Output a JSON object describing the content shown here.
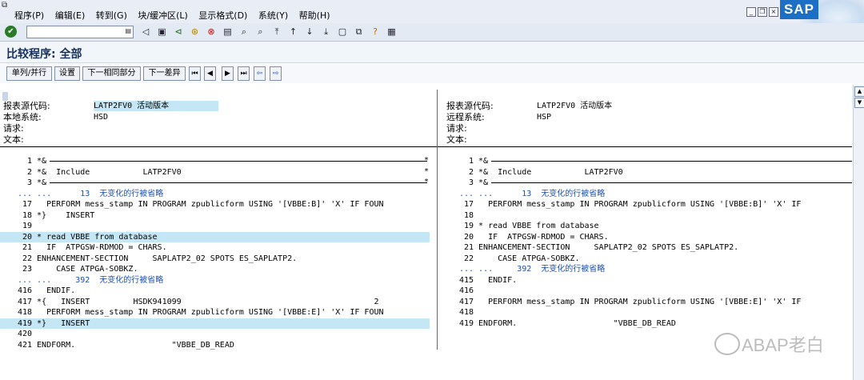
{
  "menubar": {
    "items": [
      "程序(P)",
      "编辑(E)",
      "转到(G)",
      "块/缓冲区(L)",
      "显示格式(D)",
      "系统(Y)",
      "帮助(H)"
    ],
    "logo": "SAP"
  },
  "toolbar": {
    "command_value": "",
    "icons": [
      "enter-icon",
      "back-icon",
      "exit-icon",
      "cancel-icon",
      "print-icon",
      "find-icon",
      "find-next-icon",
      "first-page-icon",
      "prev-page-icon",
      "next-page-icon",
      "last-page-icon",
      "new-session-icon",
      "shortcut-icon",
      "help-icon",
      "layout-icon"
    ]
  },
  "title": "比较程序: 全部",
  "app_toolbar": {
    "btn_split": "单列/并行",
    "btn_settings": "设置",
    "btn_next_same": "下一相同部分",
    "btn_next_diff": "下一差异"
  },
  "left": {
    "header": [
      {
        "label": "报表源代码:",
        "value": "LATP2FV0 活动版本"
      },
      {
        "label": "本地系统:",
        "value": "HSD"
      },
      {
        "label": "请求:",
        "value": ""
      },
      {
        "label": "文本:",
        "value": ""
      }
    ],
    "lines": [
      {
        "n": "1",
        "t": "*&"
      },
      {
        "n": "2",
        "t": "*&  Include           LATP2FV0"
      },
      {
        "n": "3",
        "t": "*&"
      },
      {
        "n": "...",
        "t": "...      13  无变化的行被省略"
      },
      {
        "n": "17",
        "t": "  PERFORM mess_stamp IN PROGRAM zpublicform USING '[VBBE:B]' 'X' IF FOUN"
      },
      {
        "n": "18",
        "t": "*}    INSERT"
      },
      {
        "n": "19",
        "t": ""
      },
      {
        "n": "20",
        "t": "* read VBBE from database"
      },
      {
        "n": "21",
        "t": "  IF  ATPGSW-RDMOD = CHARS."
      },
      {
        "n": "22",
        "t": "ENHANCEMENT-SECTION     SAPLATP2_02 SPOTS ES_SAPLATP2."
      },
      {
        "n": "23",
        "t": "    CASE ATPGA-SOBKZ."
      },
      {
        "n": "...",
        "t": "...     392  无变化的行被省略"
      },
      {
        "n": "416",
        "t": "  ENDIF."
      },
      {
        "n": "417",
        "t": "*{   INSERT         HSDK941099                                        2"
      },
      {
        "n": "418",
        "t": "  PERFORM mess_stamp IN PROGRAM zpublicform USING '[VBBE:E]' 'X' IF FOUN"
      },
      {
        "n": "419",
        "t": "*}   INSERT"
      },
      {
        "n": "420",
        "t": ""
      },
      {
        "n": "421",
        "t": "ENDFORM.                    \"VBBE_DB_READ"
      }
    ]
  },
  "right": {
    "header": [
      {
        "label": "报表源代码:",
        "value": "LATP2FV0 活动版本"
      },
      {
        "label": "远程系统:",
        "value": "HSP"
      },
      {
        "label": "请求:",
        "value": ""
      },
      {
        "label": "文本:",
        "value": ""
      }
    ],
    "lines": [
      {
        "n": "1",
        "t": "*&"
      },
      {
        "n": "2",
        "t": "*&  Include           LATP2FV0"
      },
      {
        "n": "3",
        "t": "*&"
      },
      {
        "n": "...",
        "t": "...      13  无变化的行被省略"
      },
      {
        "n": "17",
        "t": "  PERFORM mess_stamp IN PROGRAM zpublicform USING '[VBBE:B]' 'X' IF"
      },
      {
        "n": "18",
        "t": ""
      },
      {
        "n": "19",
        "t": "* read VBBE from database"
      },
      {
        "n": "20",
        "t": "  IF  ATPGSW-RDMOD = CHARS."
      },
      {
        "n": "21",
        "t": "ENHANCEMENT-SECTION     SAPLATP2_02 SPOTS ES_SAPLATP2."
      },
      {
        "n": "22",
        "t": "    CASE ATPGA-SOBKZ."
      },
      {
        "n": "...",
        "t": "...     392  无变化的行被省略"
      },
      {
        "n": "415",
        "t": "  ENDIF."
      },
      {
        "n": "416",
        "t": ""
      },
      {
        "n": "417",
        "t": "  PERFORM mess_stamp IN PROGRAM zpublicform USING '[VBBE:E]' 'X' IF"
      },
      {
        "n": "418",
        "t": ""
      },
      {
        "n": "419",
        "t": "ENDFORM.                    \"VBBE_DB_READ"
      }
    ]
  },
  "colors": {
    "highlight": "#c4e6f5",
    "skip": "#1d4fb0"
  },
  "watermark": "ABAP老白"
}
